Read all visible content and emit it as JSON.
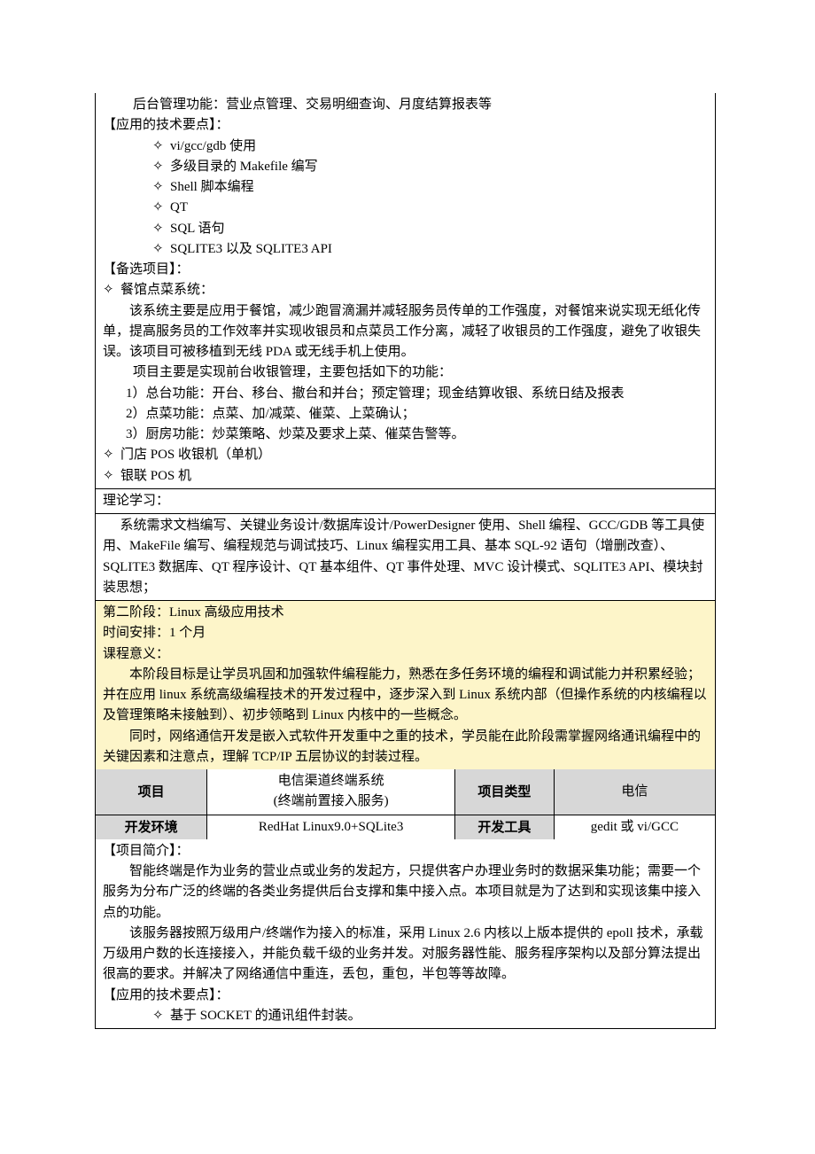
{
  "section1": {
    "line_backend": "后台管理功能：营业点管理、交易明细查询、月度结算报表等",
    "tech_heading": "【应用的技术要点】：",
    "tech_items": [
      "vi/gcc/gdb 使用",
      "多级目录的 Makefile 编写",
      "Shell 脚本编程",
      "QT",
      "SQL 语句",
      "SQLITE3 以及 SQLITE3 API"
    ],
    "alt_heading": "【备选项目】：",
    "alt1_title": "餐馆点菜系统：",
    "alt1_p1": "该系统主要是应用于餐馆，减少跑冒滴漏并减轻服务员传单的工作强度，对餐馆来说实现无纸化传单，提高服务员的工作效率并实现收银员和点菜员工作分离，减轻了收银员的工作强度，避免了收银失误。该项目可被移植到无线 PDA 或无线手机上使用。",
    "alt1_p2": "项目主要是实现前台收银管理，主要包括如下的功能：",
    "alt1_items": [
      "1）总台功能：开台、移台、撤台和并台；预定管理；现金结算收银、系统日结及报表",
      "2）点菜功能：点菜、加/减菜、催菜、上菜确认；",
      "3）厨房功能：炒菜策略、炒菜及要求上菜、催菜告警等。"
    ],
    "alt2": "门店 POS 收银机（单机）",
    "alt3": "银联 POS 机"
  },
  "theory": {
    "heading": "理论学习：",
    "body": "系统需求文档编写、关键业务设计/数据库设计/PowerDesigner 使用、Shell 编程、GCC/GDB 等工具使用、MakeFile 编写、编程规范与调试技巧、Linux 编程实用工具、基本 SQL-92 语句（增删改查）、SQLITE3 数据库、QT 程序设计、QT 基本组件、QT 事件处理、MVC 设计模式、SQLITE3 API、模块封装思想；"
  },
  "phase2": {
    "title": "第二阶段：Linux 高级应用技术",
    "time": "时间安排：1 个月",
    "meaning_label": "课程意义：",
    "p1": "本阶段目标是让学员巩固和加强软件编程能力，熟悉在多任务环境的编程和调试能力并积累经验；并在应用 linux 系统高级编程技术的开发过程中，逐步深入到 Linux 系统内部（但操作系统的内核编程以及管理策略未接触到）、初步领略到 Linux 内核中的一些概念。",
    "p2": "同时，网络通信开发是嵌入式软件开发重中之重的技术，学员能在此阶段需掌握网络通讯编程中的关键因素和注意点，理解 TCP/IP 五层协议的封装过程。"
  },
  "table": {
    "h_project": "项目",
    "project_l1": "电信渠道终端系统",
    "project_l2": "(终端前置接入服务)",
    "h_type": "项目类型",
    "type_val": "电信",
    "h_env": "开发环境",
    "env_val": "RedHat Linux9.0+SQLite3",
    "h_tool": "开发工具",
    "tool_val": "gedit 或 vi/GCC"
  },
  "section3": {
    "intro_heading": "【项目简介】：",
    "p1": "智能终端是作为业务的营业点或业务的发起方，只提供客户办理业务时的数据采集功能；需要一个服务为分布广泛的终端的各类业务提供后台支撑和集中接入点。本项目就是为了达到和实现该集中接入点的功能。",
    "p2": "该服务器按照万级用户/终端作为接入的标准，采用 Linux 2.6 内核以上版本提供的 epoll 技术，承载万级用户数的长连接接入，并能负载千级的业务并发。对服务器性能、服务程序架构以及部分算法提出很高的要求。并解决了网络通信中重连，丢包，重包，半包等等故障。",
    "tech_heading": "【应用的技术要点】：",
    "tech1": "基于 SOCKET 的通讯组件封装。"
  },
  "glyph": {
    "diamond": "✧"
  }
}
